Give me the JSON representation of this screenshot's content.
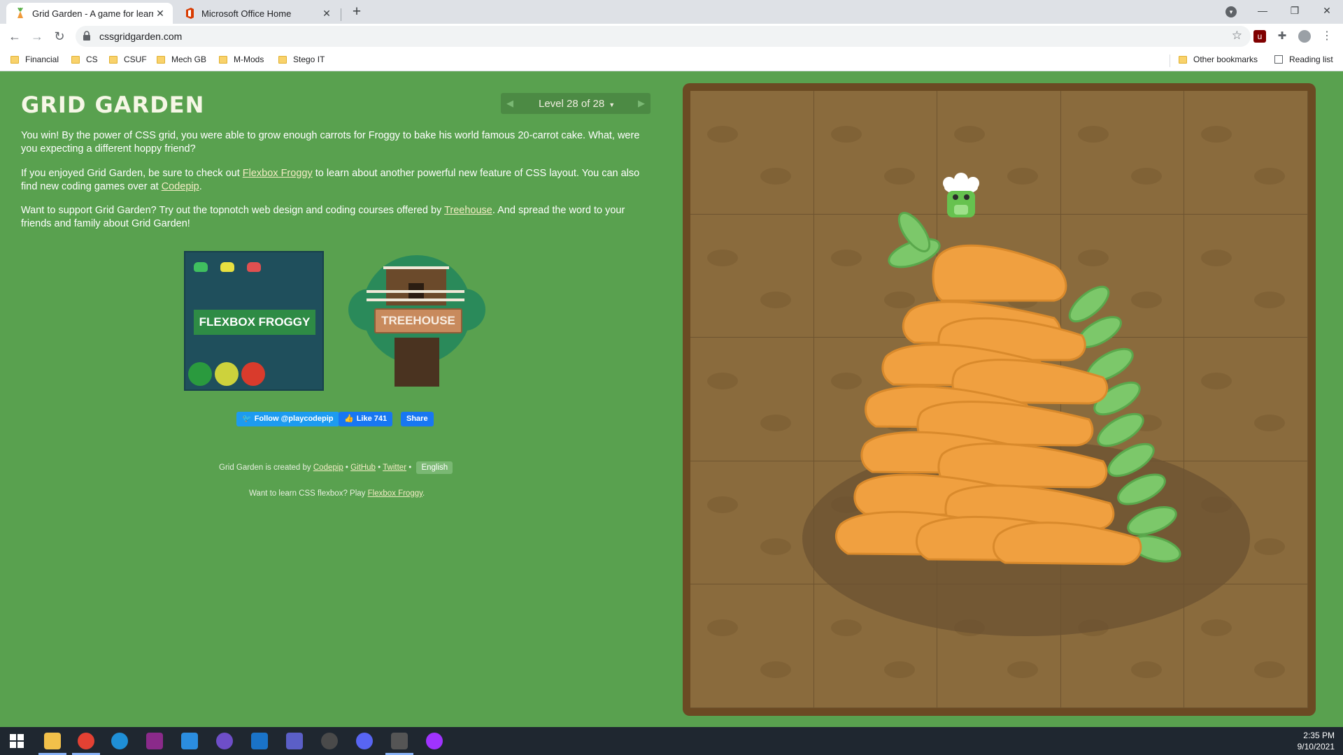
{
  "browser": {
    "tabs": [
      {
        "title": "Grid Garden - A game for learnin",
        "active": true
      },
      {
        "title": "Microsoft Office Home",
        "active": false
      }
    ],
    "url": "cssgridgarden.com",
    "bookmarks": [
      "Financial",
      "CS",
      "CSUF",
      "Mech GB",
      "M-Mods",
      "Stego IT"
    ],
    "other_bookmarks": "Other bookmarks",
    "reading_list": "Reading list"
  },
  "page": {
    "title": "GRID GARDEN",
    "level": "Level 28 of 28",
    "paragraphs": {
      "p1": "You win! By the power of CSS grid, you were able to grow enough carrots for Froggy to bake his world famous 20-carrot cake. What, were you expecting a different hoppy friend?",
      "p2_a": "If you enjoyed Grid Garden, be sure to check out ",
      "p2_link1": "Flexbox Froggy",
      "p2_b": " to learn about another powerful new feature of CSS layout. You can also find new coding games over at ",
      "p2_link2": "Codepip",
      "p2_c": ".",
      "p3_a": "Want to support Grid Garden? Try out the topnotch web design and coding courses offered by ",
      "p3_link": "Treehouse",
      "p3_b": ". And spread the word to your friends and family about Grid Garden!"
    },
    "promo_froggy": "FLEXBOX FROGGY",
    "promo_treehouse": "TREEHOUSE",
    "social": {
      "follow": "Follow @playcodepip",
      "like": "Like 741",
      "share": "Share"
    },
    "footer": {
      "created_by": "Grid Garden is created by ",
      "codepip": "Codepip",
      "sep": " • ",
      "github": "GitHub",
      "twitter": "Twitter",
      "language": "English",
      "flexbox_prompt": "Want to learn CSS flexbox? Play ",
      "flexbox_link": "Flexbox Froggy",
      "flexbox_end": "."
    }
  },
  "taskbar": {
    "time": "2:35 PM",
    "date": "9/10/2021"
  },
  "colors": {
    "page_bg": "#59a14f",
    "carrot": "#f0a040",
    "carrot_top": "#7cc86a",
    "soil": "#8a6b3d",
    "frame": "#6b4a23"
  }
}
